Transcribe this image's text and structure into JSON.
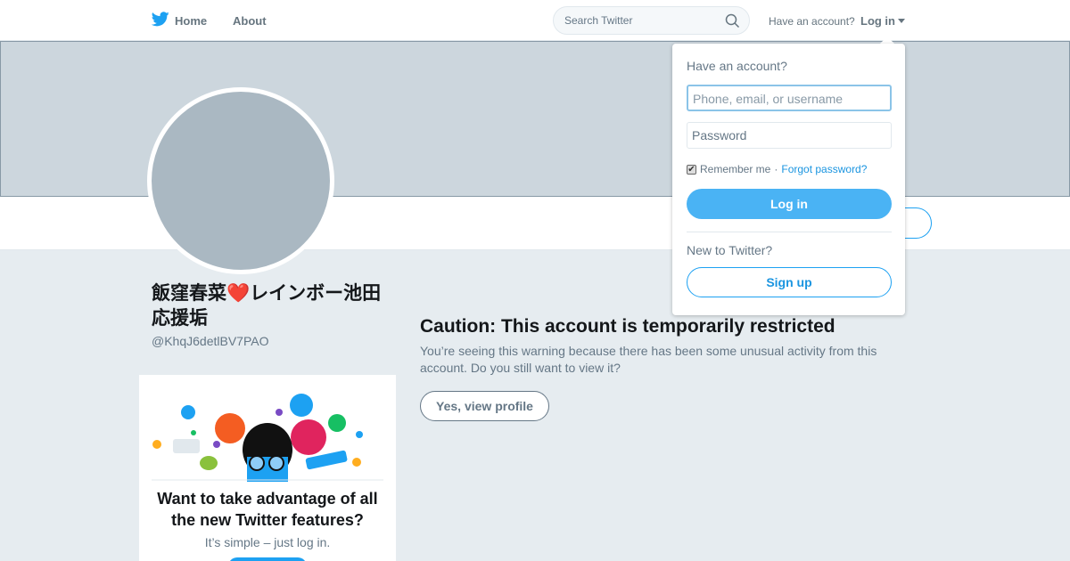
{
  "nav": {
    "home_label": "Home",
    "about_label": "About",
    "search_placeholder": "Search Twitter",
    "have_account": "Have an account?",
    "login_label": "Log in"
  },
  "profile": {
    "display_name": "飯窪春菜❤️レインボー池田応援垢",
    "screen_name": "@KhqJ6detlBV7PAO"
  },
  "promo": {
    "title": "Want to take advantage of all the new Twitter features?",
    "subtitle": "It’s simple – just log in."
  },
  "caution": {
    "title": "Caution: This account is temporarily restricted",
    "body": "You’re seeing this warning because there has been some unusual activity from this account. Do you still want to view it?",
    "button": "Yes, view profile"
  },
  "login_dropdown": {
    "header": "Have an account?",
    "username_placeholder": "Phone, email, or username",
    "password_placeholder": "Password",
    "remember_label": "Remember me",
    "separator": " · ",
    "forgot_label": "Forgot password?",
    "login_button": "Log in",
    "new_label": "New to Twitter?",
    "signup_button": "Sign up",
    "remember_checked": true
  },
  "colors": {
    "brand": "#1da1f2",
    "banner": "#ccd6dd",
    "avatar": "#aab8c2",
    "background": "#e6ecf0"
  }
}
